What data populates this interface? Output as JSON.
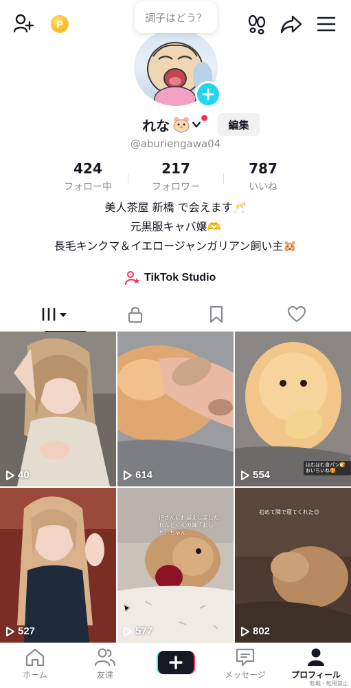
{
  "header": {
    "add_friend_icon": "person-plus-icon",
    "coin_label": "P",
    "footprints_icon": "footprints-icon",
    "share_icon": "share-arrow-icon",
    "menu_icon": "hamburger-menu-icon"
  },
  "mood_prompt": "調子はどう？",
  "profile": {
    "name": "れな",
    "handle": "@aburiengawa04",
    "edit_label": "編集"
  },
  "stats": [
    {
      "value": "424",
      "label": "フォロー中"
    },
    {
      "value": "217",
      "label": "フォロワー"
    },
    {
      "value": "787",
      "label": "いいね"
    }
  ],
  "bio": {
    "line1": "美人茶屋 新橋 で会えます🥂",
    "line2": "元黒服キャバ嬢🫶",
    "line3": "長毛キンクマ＆イエロージャンガリアン飼い主🐹"
  },
  "studio_label": "TikTok Studio",
  "tabs": [
    "videos-grid",
    "private-lock",
    "favorites-bookmark",
    "liked-heart"
  ],
  "videos": [
    {
      "views": "40"
    },
    {
      "views": "614"
    },
    {
      "views": "554",
      "caption": "はむはむ食パン🍞 おいちいね🥰"
    },
    {
      "views": "527"
    },
    {
      "views": "577",
      "caption": "JRさんにお迎えしました れんとくんの妹「おもち」ちゃん"
    },
    {
      "views": "802",
      "caption": "初めて隣で寝てくれた😊"
    }
  ],
  "bottom_nav": {
    "home": "ホーム",
    "friends": "友達",
    "messages": "メッセージ",
    "profile": "プロフィール"
  },
  "footer_note": "転載・転用禁止",
  "colors": {
    "accent_red": "#fe2c55",
    "accent_cyan": "#20d5ec",
    "text_primary": "#161823",
    "text_secondary": "#8a8b91"
  }
}
